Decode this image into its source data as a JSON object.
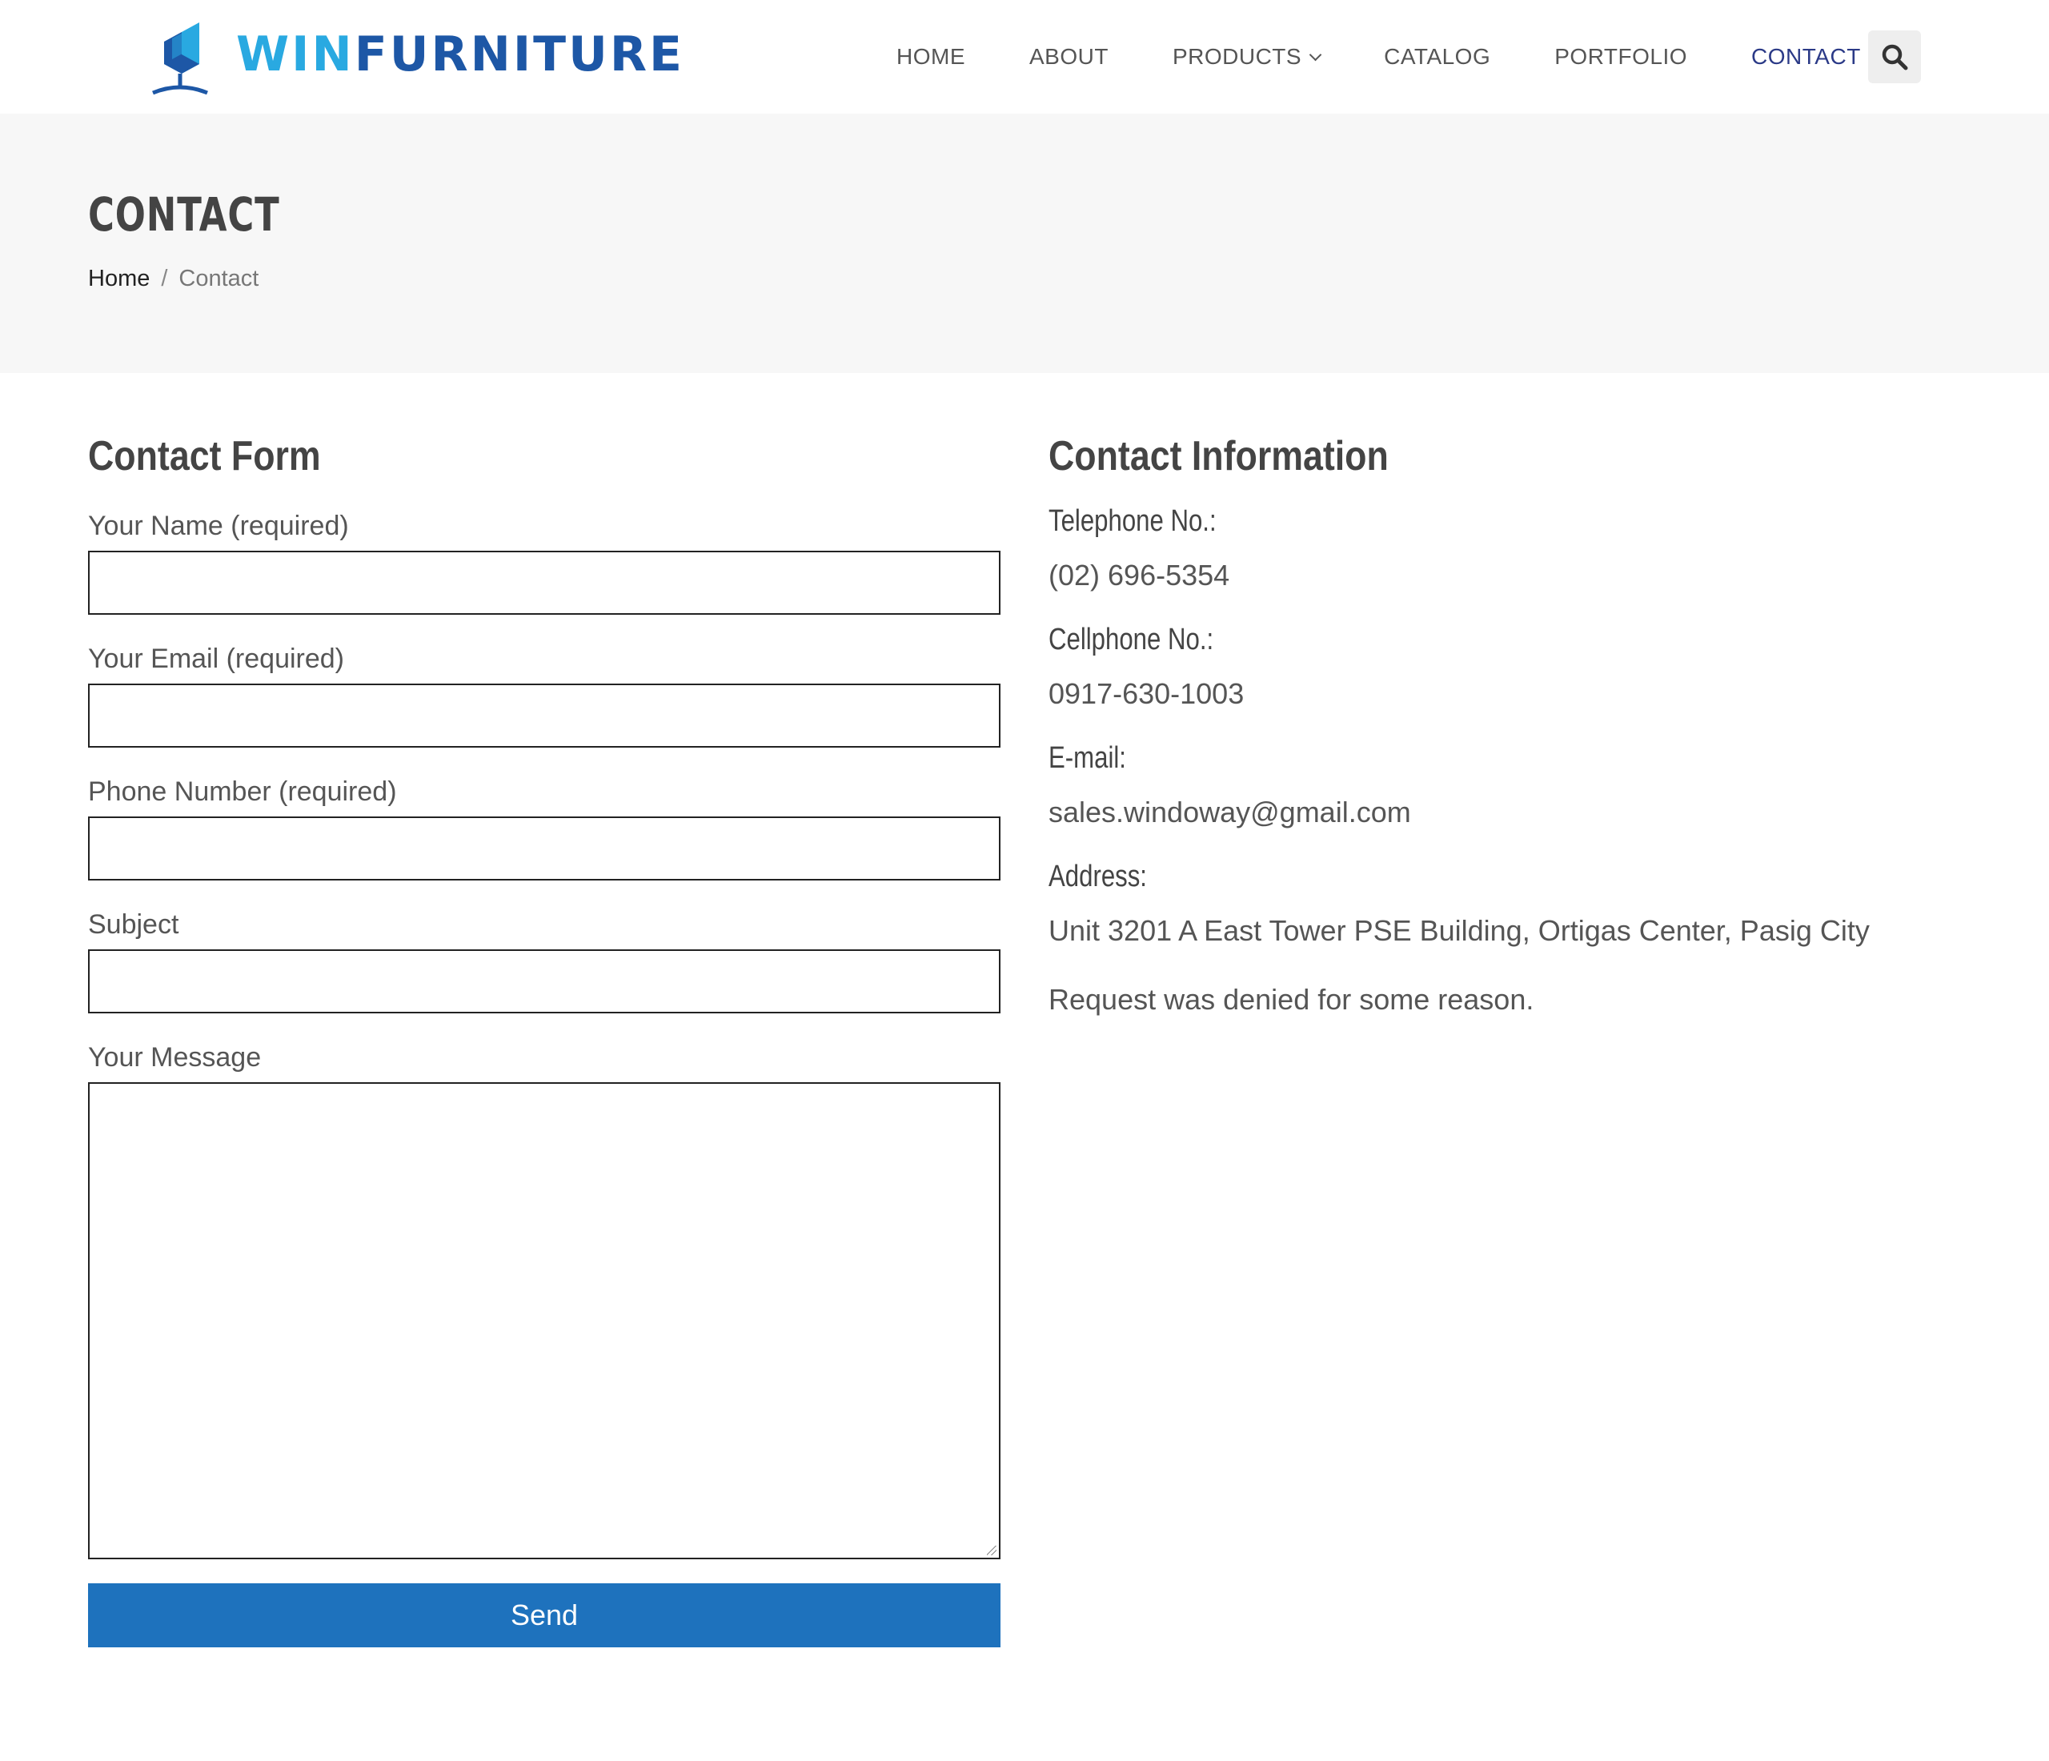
{
  "brand": {
    "logo_part1": "WIN",
    "logo_part2": "FURNITURE",
    "colors": {
      "logo_light": "#29a9e1",
      "logo_dark": "#1d57a6"
    }
  },
  "nav": {
    "home": "HOME",
    "about": "ABOUT",
    "products": "PRODUCTS",
    "catalog": "CATALOG",
    "portfolio": "PORTFOLIO",
    "contact": "CONTACT",
    "active_color": "#2b3a87",
    "search_icon": "search-icon"
  },
  "page": {
    "title": "CONTACT",
    "breadcrumb": {
      "home": "Home",
      "separator": "/",
      "current": "Contact"
    }
  },
  "form": {
    "title": "Contact Form",
    "name_label": "Your Name (required)",
    "email_label": "Your Email (required)",
    "phone_label": "Phone Number (required)",
    "subject_label": "Subject",
    "message_label": "Your Message",
    "name_value": "",
    "email_value": "",
    "phone_value": "",
    "subject_value": "",
    "message_value": "",
    "send_label": "Send",
    "send_color": "#1e72bd"
  },
  "info": {
    "title": "Contact Information",
    "telephone_label": "Telephone No.:",
    "telephone_value": "(02) 696-5354",
    "cellphone_label": "Cellphone No.:",
    "cellphone_value": "0917-630-1003",
    "email_label": "E-mail:",
    "email_value": "sales.windoway@gmail.com",
    "address_label": "Address:",
    "address_value": "Unit 3201 A East Tower PSE Building, Ortigas Center, Pasig City",
    "status_message": "Request was denied for some reason."
  }
}
